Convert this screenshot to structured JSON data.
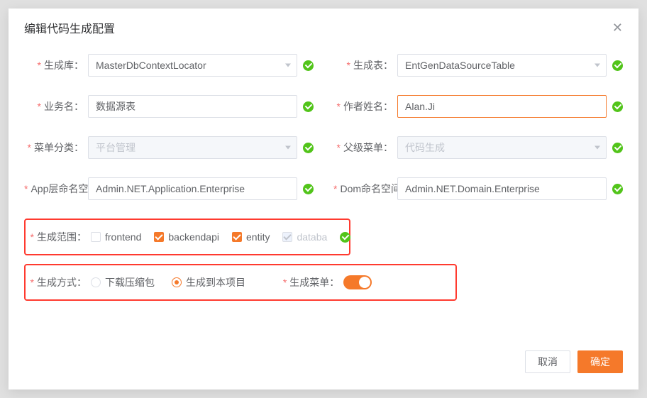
{
  "dialog": {
    "title": "编辑代码生成配置",
    "close_aria": "关闭"
  },
  "labels": {
    "gen_lib": "生成库：",
    "gen_table": "生成表：",
    "biz_name": "业务名：",
    "author_name": "作者姓名：",
    "menu_category": "菜单分类：",
    "parent_menu": "父级菜单：",
    "app_ns": "App层命名空",
    "dom_ns": "Dom命名空间",
    "gen_scope": "生成范围：",
    "gen_mode": "生成方式：",
    "gen_menu": "生成菜单："
  },
  "values": {
    "gen_lib": "MasterDbContextLocator",
    "gen_table": "EntGenDataSourceTable",
    "biz_name": "数据源表",
    "author_name": "Alan.Ji",
    "menu_category": "平台管理",
    "parent_menu": "代码生成",
    "app_ns": "Admin.NET.Application.Enterprise",
    "dom_ns": "Admin.NET.Domain.Enterprise"
  },
  "scope": {
    "frontend": {
      "label": "frontend",
      "checked": false,
      "disabled": false
    },
    "backendapi": {
      "label": "backendapi",
      "checked": true,
      "disabled": false
    },
    "entity": {
      "label": "entity",
      "checked": true,
      "disabled": false
    },
    "database": {
      "label": "databa",
      "checked": true,
      "disabled": true
    }
  },
  "mode": {
    "download": {
      "label": "下载压缩包",
      "checked": false
    },
    "to_project": {
      "label": "生成到本项目",
      "checked": true
    }
  },
  "gen_menu_on": true,
  "footer": {
    "cancel": "取消",
    "ok": "确定"
  }
}
